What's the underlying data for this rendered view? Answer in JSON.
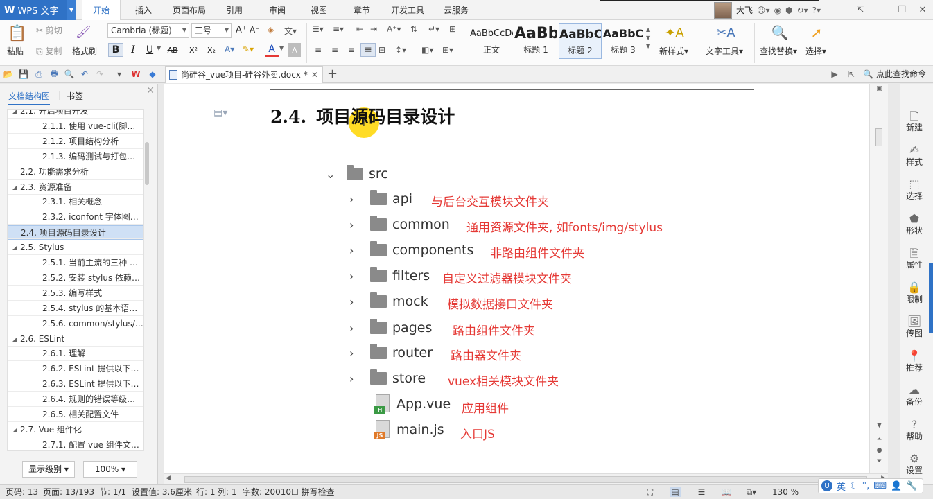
{
  "app": {
    "name": "WPS 文字",
    "logo": "W"
  },
  "menu": {
    "tabs": [
      "开始",
      "插入",
      "页面布局",
      "引用",
      "审阅",
      "视图",
      "章节",
      "开发工具",
      "云服务"
    ],
    "active": "开始"
  },
  "user": {
    "name": "大飞"
  },
  "ribbon": {
    "paste": "粘贴",
    "cut": "剪切",
    "copy": "复制",
    "format_painter": "格式刷",
    "font_name": "Cambria (标题)",
    "font_size": "三号",
    "bold": "B",
    "italic": "I",
    "underline": "U",
    "strike": "AB",
    "superscript": "X²",
    "subscript": "X₂",
    "font_color": "A",
    "styles": [
      {
        "sample": "AaBbCcDd",
        "caption": "正文"
      },
      {
        "sample": "AaBb",
        "caption": "标题 1"
      },
      {
        "sample": "AaBbC",
        "caption": "标题 2"
      },
      {
        "sample": "AaBbC",
        "caption": "标题 3"
      }
    ],
    "new_style": "新样式",
    "text_tools": "文字工具",
    "find_replace": "查找替换",
    "select": "选择"
  },
  "doc_tab": {
    "title": "尚硅谷_vue项目-硅谷外卖.docx *"
  },
  "find_command": "点此查找命令",
  "nav": {
    "tabs": [
      "文档结构图",
      "书签"
    ],
    "items": [
      {
        "level": 2,
        "text": "2.1. 开启项目开发",
        "expanded": true
      },
      {
        "level": 3,
        "text": "2.1.1. 使用 vue-cli(脚…"
      },
      {
        "level": 3,
        "text": "2.1.2. 项目结构分析"
      },
      {
        "level": 3,
        "text": "2.1.3. 编码测试与打包…"
      },
      {
        "level": 2,
        "text": "2.2. 功能需求分析"
      },
      {
        "level": 2,
        "text": "2.3. 资源准备",
        "expanded": true
      },
      {
        "level": 3,
        "text": "2.3.1. 相关概念"
      },
      {
        "level": 3,
        "text": "2.3.2. iconfont 字体图…"
      },
      {
        "level": 2,
        "text": "2.4. 项目源码目录设计",
        "selected": true
      },
      {
        "level": 2,
        "text": "2.5. Stylus",
        "expanded": true
      },
      {
        "level": 3,
        "text": "2.5.1. 当前主流的三种 …"
      },
      {
        "level": 3,
        "text": "2.5.2. 安装 stylus 依赖…"
      },
      {
        "level": 3,
        "text": "2.5.3. 编写样式"
      },
      {
        "level": 3,
        "text": "2.5.4. stylus 的基本语…"
      },
      {
        "level": 3,
        "text": "2.5.6. common/stylus/…"
      },
      {
        "level": 2,
        "text": "2.6. ESLint",
        "expanded": true
      },
      {
        "level": 3,
        "text": "2.6.1. 理解"
      },
      {
        "level": 3,
        "text": "2.6.2. ESLint 提供以下…"
      },
      {
        "level": 3,
        "text": "2.6.3. ESLint 提供以下…"
      },
      {
        "level": 3,
        "text": "2.6.4. 规则的错误等级…"
      },
      {
        "level": 3,
        "text": "2.6.5. 相关配置文件"
      },
      {
        "level": 2,
        "text": "2.7. Vue 组件化",
        "expanded": true
      },
      {
        "level": 3,
        "text": "2.7.1. 配置 vue 组件文…"
      }
    ],
    "show_level": "显示级别",
    "zoom": "100%"
  },
  "document": {
    "heading_num": "2.4.",
    "heading_text": "项目源码目录设计",
    "root": "src",
    "folders": [
      {
        "name": "api",
        "desc": "与后台交互模块文件夹"
      },
      {
        "name": "common",
        "desc": "通用资源文件夹, 如fonts/img/stylus"
      },
      {
        "name": "components",
        "desc": "非路由组件文件夹"
      },
      {
        "name": "filters",
        "desc": "自定义过滤器模块文件夹"
      },
      {
        "name": "mock",
        "desc": "模拟数据接口文件夹"
      },
      {
        "name": "pages",
        "desc": "路由组件文件夹"
      },
      {
        "name": "router",
        "desc": "路由器文件夹"
      },
      {
        "name": "store",
        "desc": "vuex相关模块文件夹"
      }
    ],
    "files": [
      {
        "name": "App.vue",
        "desc": "应用组件",
        "tag": "H"
      },
      {
        "name": "main.js",
        "desc": "入口JS",
        "tag": "JS"
      }
    ]
  },
  "right_pane": [
    "新建",
    "样式",
    "选择",
    "形状",
    "属性",
    "限制",
    "传图",
    "推荐",
    "备份",
    "帮助",
    "设置"
  ],
  "status": {
    "page_num": "页码: 13",
    "pages": "页面: 13/193",
    "section": "节: 1/1",
    "set_value": "设置值: 3.6厘米",
    "row": "行: 1",
    "col": "列: 1",
    "word_count": "字数: 20010",
    "spell_check": "拼写检查",
    "zoom": "130 %"
  },
  "ime": {
    "lang": "英"
  }
}
